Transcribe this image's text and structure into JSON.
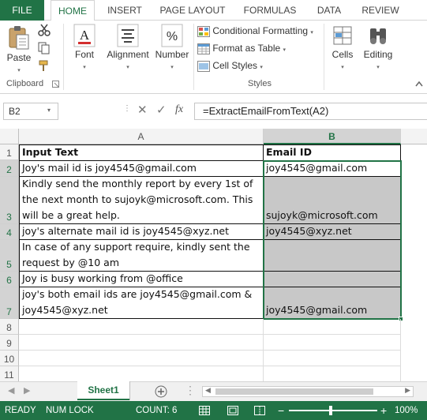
{
  "ribbon": {
    "tabs": [
      "FILE",
      "HOME",
      "INSERT",
      "PAGE LAYOUT",
      "FORMULAS",
      "DATA",
      "REVIEW"
    ],
    "clipboard": {
      "paste": "Paste",
      "group": "Clipboard"
    },
    "font": "Font",
    "alignment": "Alignment",
    "number": "Number",
    "styles": {
      "conditional": "Conditional Formatting",
      "table": "Format as Table",
      "cell_styles": "Cell Styles",
      "group": "Styles"
    },
    "cells": "Cells",
    "editing": "Editing"
  },
  "formula_bar": {
    "name_box": "B2",
    "formula": "=ExtractEmailFromText(A2)"
  },
  "grid": {
    "col_a": "A",
    "col_b": "B",
    "row_numbers": [
      "1",
      "2",
      "3",
      "4",
      "5",
      "6",
      "7",
      "8",
      "9",
      "10",
      "11"
    ],
    "header_a": "Input Text",
    "header_b": "Email ID",
    "rows": [
      {
        "a": "Joy's mail id is joy4545@gmail.com",
        "b": "joy4545@gmail.com"
      },
      {
        "a": "Kindly send the monthly report by every 1st of the next month to sujoyk@microsoft.com. This will be a great help.",
        "b": "sujoyk@microsoft.com"
      },
      {
        "a": "joy's alternate mail id is joy4545@xyz.net",
        "b": "joy4545@xyz.net"
      },
      {
        "a": "In case of any support require, kindly sent the request by @10 am",
        "b": ""
      },
      {
        "a": "Joy is busy working from @office",
        "b": ""
      },
      {
        "a": "joy's both email ids are joy4545@gmail.com & joy4545@xyz.net",
        "b": "joy4545@gmail.com"
      }
    ]
  },
  "sheet_tab": "Sheet1",
  "status": {
    "ready": "READY",
    "num_lock": "NUM LOCK",
    "count": "COUNT: 6",
    "zoom": "100%"
  },
  "colors": {
    "accent": "#217346",
    "selection_fill": "#c8c8c8"
  }
}
